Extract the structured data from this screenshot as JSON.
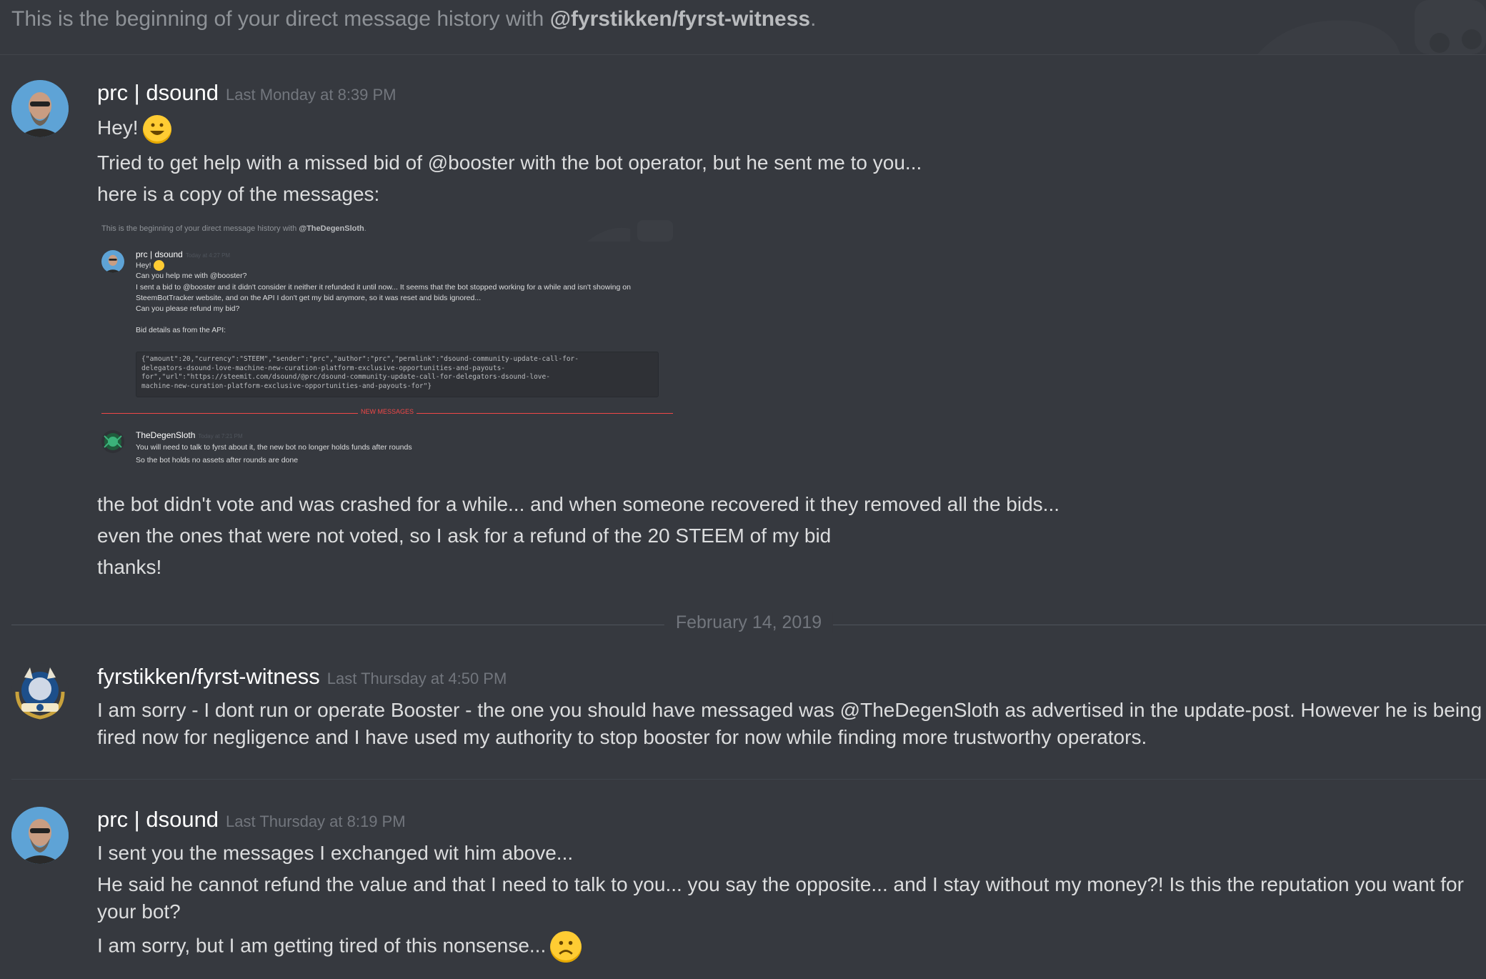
{
  "banner": {
    "prefix": "This is the beginning of your direct message history with ",
    "handle": "@fyrstikken/fyrst-witness",
    "suffix": "."
  },
  "messages": [
    {
      "author": "prc | dsound",
      "timestamp": "Last Monday at 8:39 PM",
      "lines": [
        "Hey!",
        "Tried to get help with a missed bid of @booster with the bot operator, but he sent me to you...",
        "here is a copy of the messages:",
        "the bot didn't vote and was crashed for a while... and when someone recovered it they removed all the bids...",
        "even the ones that were not voted, so I ask for a refund of the 20 STEEM of my bid",
        "thanks!"
      ]
    },
    {
      "author": "fyrstikken/fyrst-witness",
      "timestamp": "Last Thursday at 4:50 PM",
      "lines": [
        "I am sorry - I dont run or operate Booster - the one you should have messaged was @TheDegenSloth as advertised in the update-post. However he is being",
        "fired now for negligence and I have used my authority to stop booster for now while finding more trustworthy operators."
      ]
    },
    {
      "author": "prc | dsound",
      "timestamp": "Last Thursday at 8:19 PM",
      "lines": [
        "I sent you the messages I exchanged wit him above...",
        "He said he cannot refund the value and that I need to talk to you... you say the opposite... and I stay without my money?! Is this the reputation you want for",
        "your bot?",
        "I am sorry, but I am getting tired of this nonsense..."
      ]
    }
  ],
  "date_divider": "February 14, 2019",
  "embed": {
    "banner_prefix": "This is the beginning of your direct message history with ",
    "banner_handle": "@TheDegenSloth",
    "banner_suffix": ".",
    "msg1_author": "prc | dsound",
    "msg1_time": "Today at 4:27 PM",
    "msg1_lines": [
      "Hey!",
      "Can you help me with @booster?",
      "I sent a bid to @booster and it didn't consider it neither it refunded it until now... It seems that the bot stopped working for a while and isn't showing on",
      "SteemBotTracker website, and on the API I don't get my bid anymore, so it was reset and bids ignored...",
      "Can you please refund my bid?",
      "Bid details as from the API:"
    ],
    "code": "{\"amount\":20,\"currency\":\"STEEM\",\"sender\":\"prc\",\"author\":\"prc\",\"permlink\":\"dsound-community-update-call-for-\ndelegators-dsound-love-machine-new-curation-platform-exclusive-opportunities-and-payouts-\nfor\",\"url\":\"https://steemit.com/dsound/@prc/dsound-community-update-call-for-delegators-dsound-love-\nmachine-new-curation-platform-exclusive-opportunities-and-payouts-for\"}",
    "new_messages": "NEW MESSAGES",
    "msg2_author": "TheDegenSloth",
    "msg2_time": "Today at 7:21 PM",
    "msg2_lines": [
      "You will need to talk to fyrst about it, the new bot no longer holds funds after rounds",
      "So the bot holds no assets after rounds are done"
    ]
  },
  "colors": {
    "background": "#36393f",
    "username": "#ffffff",
    "timestamp": "#72767d",
    "text": "#dcddde",
    "new_messages": "#f04747"
  }
}
